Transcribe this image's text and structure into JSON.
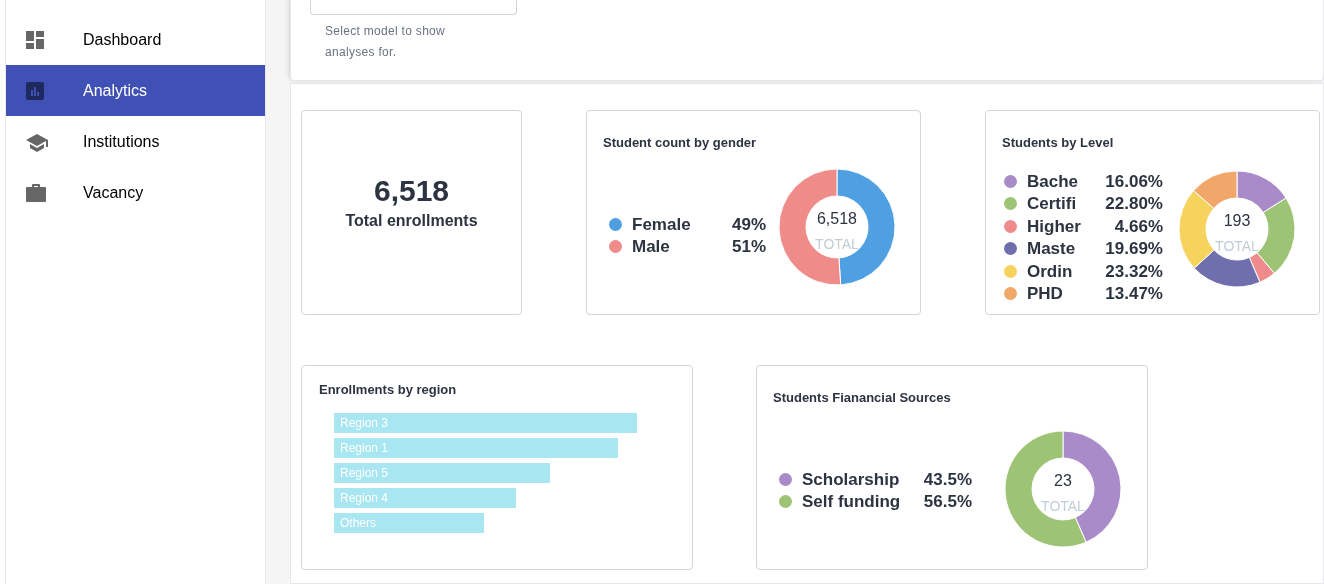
{
  "sidebar": {
    "items": [
      {
        "label": "Dashboard",
        "selected": false
      },
      {
        "label": "Analytics",
        "selected": true
      },
      {
        "label": "Institutions",
        "selected": false
      },
      {
        "label": "Vacancy",
        "selected": false
      }
    ]
  },
  "model_select": {
    "helper_text": "Select model to show analyses for."
  },
  "total_card": {
    "value": "6,518",
    "label": "Total enrollments"
  },
  "gender_card": {
    "title": "Student count by gender",
    "center_value": "6,518",
    "center_label": "TOTAL",
    "legend": [
      {
        "percent": "49%",
        "color": "#4f9fe3"
      },
      {
        "percent": "51%",
        "color": "#ef8b89"
      }
    ],
    "chart_data": {
      "type": "donut",
      "categories": [
        "Female",
        "Male"
      ],
      "values": [
        49,
        51
      ]
    }
  },
  "level_card": {
    "title": "Students by Level",
    "center_value": "193",
    "center_label": "TOTAL",
    "legend": [
      {
        "percent": "16.06%",
        "color": "#a98bc9"
      },
      {
        "percent": "22.80%",
        "color": "#9dc375"
      },
      {
        "percent": "4.66%",
        "color": "#ef8b8b"
      },
      {
        "percent": "19.69%",
        "color": "#6f6fae"
      },
      {
        "percent": "23.32%",
        "color": "#f6d35d"
      },
      {
        "percent": "13.47%",
        "color": "#f2a76a"
      }
    ],
    "chart_data": {
      "type": "donut",
      "categories": [
        "Bache",
        "Certifi",
        "Higher",
        "Maste",
        "Ordin",
        "PHD"
      ],
      "values": [
        16.06,
        22.8,
        4.66,
        19.69,
        23.32,
        13.47
      ]
    }
  },
  "region_card": {
    "title": "Enrollments by region",
    "bars": [
      "Region 3",
      "Region 1",
      "Region 5",
      "Region 4",
      "Others"
    ]
  },
  "finance_card": {
    "title": "Students Fianancial Sources",
    "center_value": "23",
    "center_label": "TOTAL",
    "legend": [
      {
        "percent": "43.5%",
        "color": "#a98bc9"
      },
      {
        "percent": "56.5%",
        "color": "#9dc375"
      }
    ],
    "chart_data": {
      "type": "donut",
      "categories": [
        "Scholarship",
        "Self funding"
      ],
      "values": [
        43.5,
        56.5
      ]
    }
  }
}
